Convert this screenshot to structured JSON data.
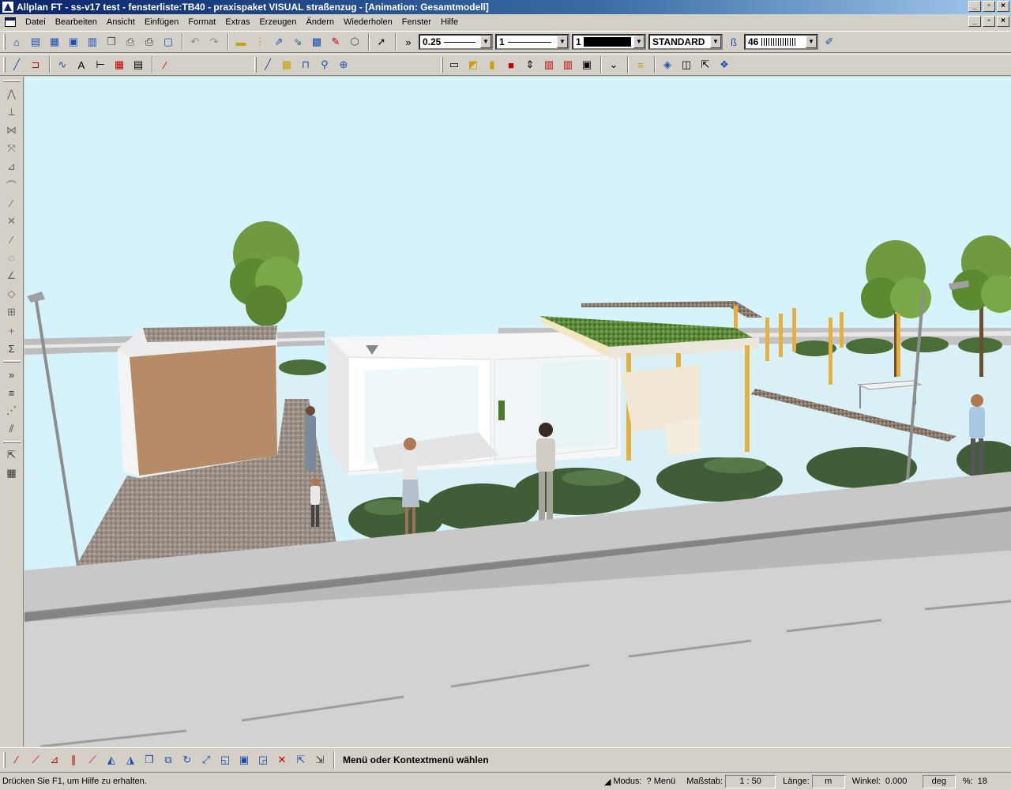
{
  "window": {
    "title": "Allplan FT - ss-v17 test - fensterliste:TB40 - praxispaket VISUAL straßenzug - [Animation: Gesamtmodell]",
    "minimize": "_",
    "restore": "▫",
    "close": "×"
  },
  "menu": {
    "items": [
      "Datei",
      "Bearbeiten",
      "Ansicht",
      "Einfügen",
      "Format",
      "Extras",
      "Erzeugen",
      "Ändern",
      "Wiederholen",
      "Fenster",
      "Hilfe"
    ]
  },
  "toolbar": {
    "pen_value": "0.25",
    "line_value": "1",
    "color_value": "1",
    "layer_value": "STANDARD",
    "hatch_value": "46"
  },
  "bottom": {
    "prompt": "Menü oder Kontextmenü wählen"
  },
  "status": {
    "help": "Drücken Sie F1, um Hilfe zu erhalten.",
    "modus_label": "Modus:",
    "modus_value": "? Menü",
    "massstab_label": "Maßstab:",
    "massstab_value": "1 : 50",
    "laenge_label": "Länge:",
    "laenge_value": "m",
    "winkel_label": "Winkel:",
    "winkel_value": "0.000",
    "winkel_unit": "deg",
    "percent_label": "%:",
    "percent_value": "18"
  },
  "colors": {
    "sky": "#d6f3fb",
    "road": "#d2d2d2",
    "title_gradient_start": "#0a246a"
  }
}
